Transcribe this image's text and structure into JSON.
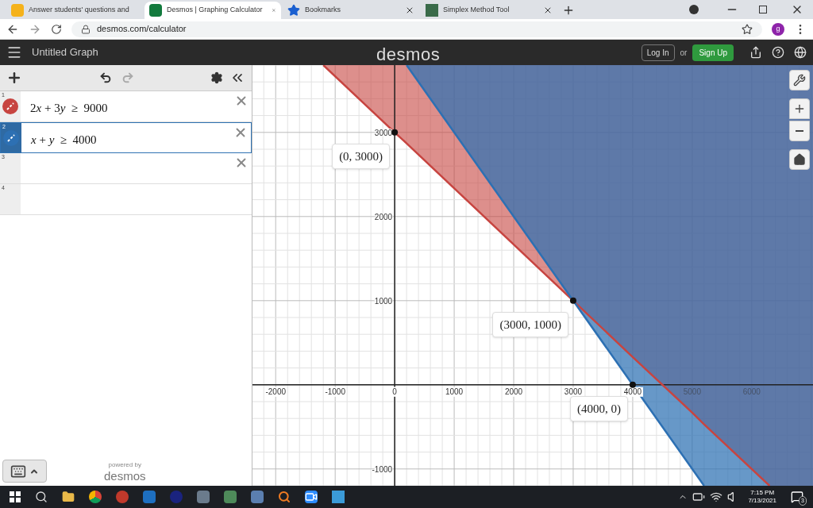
{
  "browser": {
    "tabs": [
      {
        "title": "Answer students' questions and",
        "selected": false
      },
      {
        "title": "Desmos | Graphing Calculator",
        "selected": true
      },
      {
        "title": "Bookmarks",
        "selected": false
      },
      {
        "title": "Simplex Method Tool",
        "selected": false
      }
    ],
    "address": "desmos.com/calculator",
    "profile": "g"
  },
  "header": {
    "title": "Untitled Graph",
    "logo": "desmos",
    "login": "Log In",
    "or": "or",
    "signup": "Sign Up"
  },
  "expressions": [
    {
      "number": "1",
      "kind": "expression",
      "latex": "2x + 3y  ≥  9000",
      "color": "#c74440",
      "selected": false
    },
    {
      "number": "2",
      "kind": "expression",
      "latex": "x + y  ≥  4000",
      "color": "#2d70b3",
      "selected": true
    },
    {
      "number": "3",
      "kind": "empty",
      "selected": false
    },
    {
      "number": "4",
      "kind": "new",
      "selected": false
    }
  ],
  "powered_by": {
    "caption": "powered by",
    "logo": "desmos"
  },
  "graph": {
    "chart_data": {
      "type": "line",
      "grid": true,
      "x": [
        -1200,
        0,
        200,
        3000,
        4000,
        5000,
        5200,
        6300
      ],
      "series": [
        {
          "color": "#c74440",
          "values": [
            3800,
            3000,
            2870,
            1000,
            330,
            -330,
            -470,
            -1200
          ]
        },
        {
          "color": "#2d70b3",
          "values": [
            null,
            null,
            3800,
            1000,
            0,
            -1000,
            -1200,
            null
          ]
        }
      ],
      "xlim": [
        -2390,
        7030
      ],
      "ylim": [
        -1200,
        3800
      ],
      "xticks": [
        -2000,
        -1000,
        0,
        1000,
        2000,
        3000,
        4000,
        5000,
        6000
      ],
      "yticks": [
        -1000,
        1000,
        2000,
        3000
      ],
      "annotations": [
        {
          "x": 0,
          "y": 3000,
          "text": "(0, 3000)"
        },
        {
          "x": 3000,
          "y": 1000,
          "text": "(3000, 1000)"
        },
        {
          "x": 4000,
          "y": 0,
          "text": "(4000, 0)"
        }
      ]
    }
  },
  "taskbar": {
    "time": "7:15 PM",
    "date": "7/13/2021",
    "notifications": "3"
  }
}
